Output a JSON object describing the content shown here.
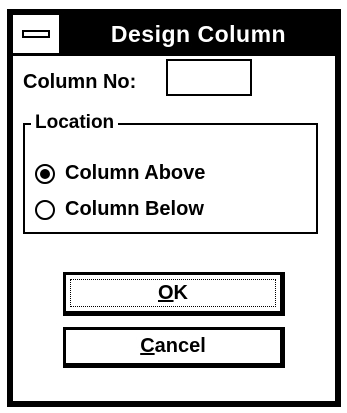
{
  "window": {
    "title": "Design Column"
  },
  "form": {
    "column_no_label": "Column No:",
    "column_no_value": ""
  },
  "location": {
    "group_label": "Location",
    "options": [
      {
        "label": "Column Above",
        "selected": true
      },
      {
        "label": "Column Below",
        "selected": false
      }
    ]
  },
  "buttons": {
    "ok": {
      "mnemonic": "O",
      "rest": "K"
    },
    "cancel": {
      "mnemonic": "C",
      "rest": "ancel"
    }
  }
}
